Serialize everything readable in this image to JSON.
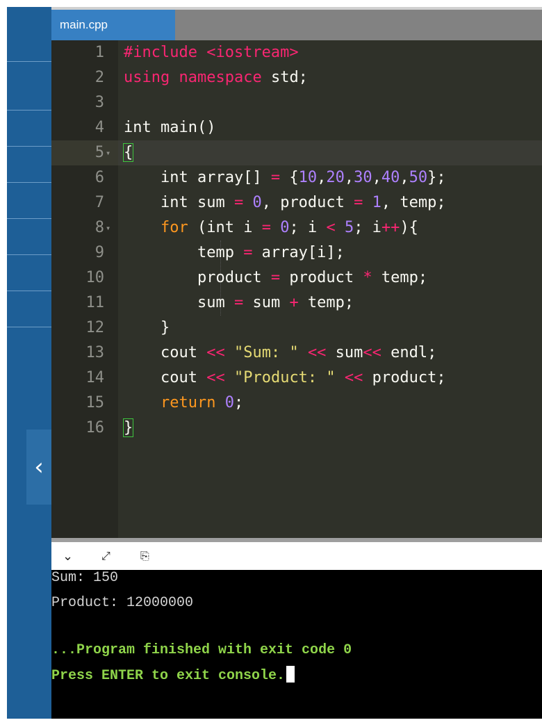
{
  "tab": {
    "filename": "main.cpp"
  },
  "editor": {
    "lines": [
      {
        "n": "1",
        "fold": "",
        "tokens": [
          [
            "pp",
            "#include <iostream>"
          ]
        ]
      },
      {
        "n": "2",
        "fold": "",
        "tokens": [
          [
            "kw",
            "using"
          ],
          [
            "t",
            " "
          ],
          [
            "kw",
            "namespace"
          ],
          [
            "t",
            " std;"
          ]
        ]
      },
      {
        "n": "3",
        "fold": "",
        "tokens": []
      },
      {
        "n": "4",
        "fold": "",
        "tokens": [
          [
            "t",
            "int main()"
          ]
        ]
      },
      {
        "n": "5",
        "fold": "▾",
        "tokens": [
          [
            "bracket",
            "{"
          ]
        ]
      },
      {
        "n": "6",
        "fold": "",
        "tokens": [
          [
            "t",
            "    int array[] "
          ],
          [
            "op",
            "="
          ],
          [
            "t",
            " {"
          ],
          [
            "num",
            "10"
          ],
          [
            "t",
            ","
          ],
          [
            "num",
            "20"
          ],
          [
            "t",
            ","
          ],
          [
            "num",
            "30"
          ],
          [
            "t",
            ","
          ],
          [
            "num",
            "40"
          ],
          [
            "t",
            ","
          ],
          [
            "num",
            "50"
          ],
          [
            "t",
            "};"
          ]
        ]
      },
      {
        "n": "7",
        "fold": "",
        "tokens": [
          [
            "t",
            "    int sum "
          ],
          [
            "op",
            "="
          ],
          [
            "t",
            " "
          ],
          [
            "num",
            "0"
          ],
          [
            "t",
            ", product "
          ],
          [
            "op",
            "="
          ],
          [
            "t",
            " "
          ],
          [
            "num",
            "1"
          ],
          [
            "t",
            ", temp;"
          ]
        ]
      },
      {
        "n": "8",
        "fold": "▾",
        "tokens": [
          [
            "t",
            "    "
          ],
          [
            "kw2",
            "for"
          ],
          [
            "t",
            " (int i "
          ],
          [
            "op",
            "="
          ],
          [
            "t",
            " "
          ],
          [
            "num",
            "0"
          ],
          [
            "t",
            "; i "
          ],
          [
            "op",
            "<"
          ],
          [
            "t",
            " "
          ],
          [
            "num",
            "5"
          ],
          [
            "t",
            "; i"
          ],
          [
            "op",
            "++"
          ],
          [
            "t",
            "){"
          ]
        ]
      },
      {
        "n": "9",
        "fold": "",
        "tokens": [
          [
            "t",
            "        temp "
          ],
          [
            "op",
            "="
          ],
          [
            "t",
            " array[i];"
          ]
        ]
      },
      {
        "n": "10",
        "fold": "",
        "tokens": [
          [
            "t",
            "        product "
          ],
          [
            "op",
            "="
          ],
          [
            "t",
            " product "
          ],
          [
            "op",
            "*"
          ],
          [
            "t",
            " temp;"
          ]
        ]
      },
      {
        "n": "11",
        "fold": "",
        "tokens": [
          [
            "t",
            "        sum "
          ],
          [
            "op",
            "="
          ],
          [
            "t",
            " sum "
          ],
          [
            "op",
            "+"
          ],
          [
            "t",
            " temp;"
          ]
        ]
      },
      {
        "n": "12",
        "fold": "",
        "tokens": [
          [
            "t",
            "    }"
          ]
        ]
      },
      {
        "n": "13",
        "fold": "",
        "tokens": [
          [
            "t",
            "    cout "
          ],
          [
            "op",
            "<<"
          ],
          [
            "t",
            " "
          ],
          [
            "str",
            "\"Sum: \""
          ],
          [
            "t",
            " "
          ],
          [
            "op",
            "<<"
          ],
          [
            "t",
            " sum"
          ],
          [
            "op",
            "<<"
          ],
          [
            "t",
            " endl;"
          ]
        ]
      },
      {
        "n": "14",
        "fold": "",
        "tokens": [
          [
            "t",
            "    cout "
          ],
          [
            "op",
            "<<"
          ],
          [
            "t",
            " "
          ],
          [
            "str",
            "\"Product: \""
          ],
          [
            "t",
            " "
          ],
          [
            "op",
            "<<"
          ],
          [
            "t",
            " product;"
          ]
        ]
      },
      {
        "n": "15",
        "fold": "",
        "tokens": [
          [
            "t",
            "    "
          ],
          [
            "kw2",
            "return"
          ],
          [
            "t",
            " "
          ],
          [
            "num",
            "0"
          ],
          [
            "t",
            ";"
          ]
        ]
      },
      {
        "n": "16",
        "fold": "",
        "tokens": [
          [
            "bracket",
            "}"
          ]
        ]
      }
    ]
  },
  "console": {
    "output": [
      "Sum: 150",
      "Product: 12000000"
    ],
    "finished": "...Program finished with exit code 0",
    "prompt": "Press ENTER to exit console."
  },
  "icons": {
    "collapse": "chevron-left-icon",
    "console_minimize": "chevron-down-icon",
    "console_expand": "expand-icon",
    "console_copy": "copy-icon"
  },
  "colors": {
    "sidebar": "#1e5f97",
    "tab_active": "#3780c3",
    "editor_bg": "#2f3129",
    "console_bg": "#000000",
    "console_message": "#8fd44a"
  }
}
